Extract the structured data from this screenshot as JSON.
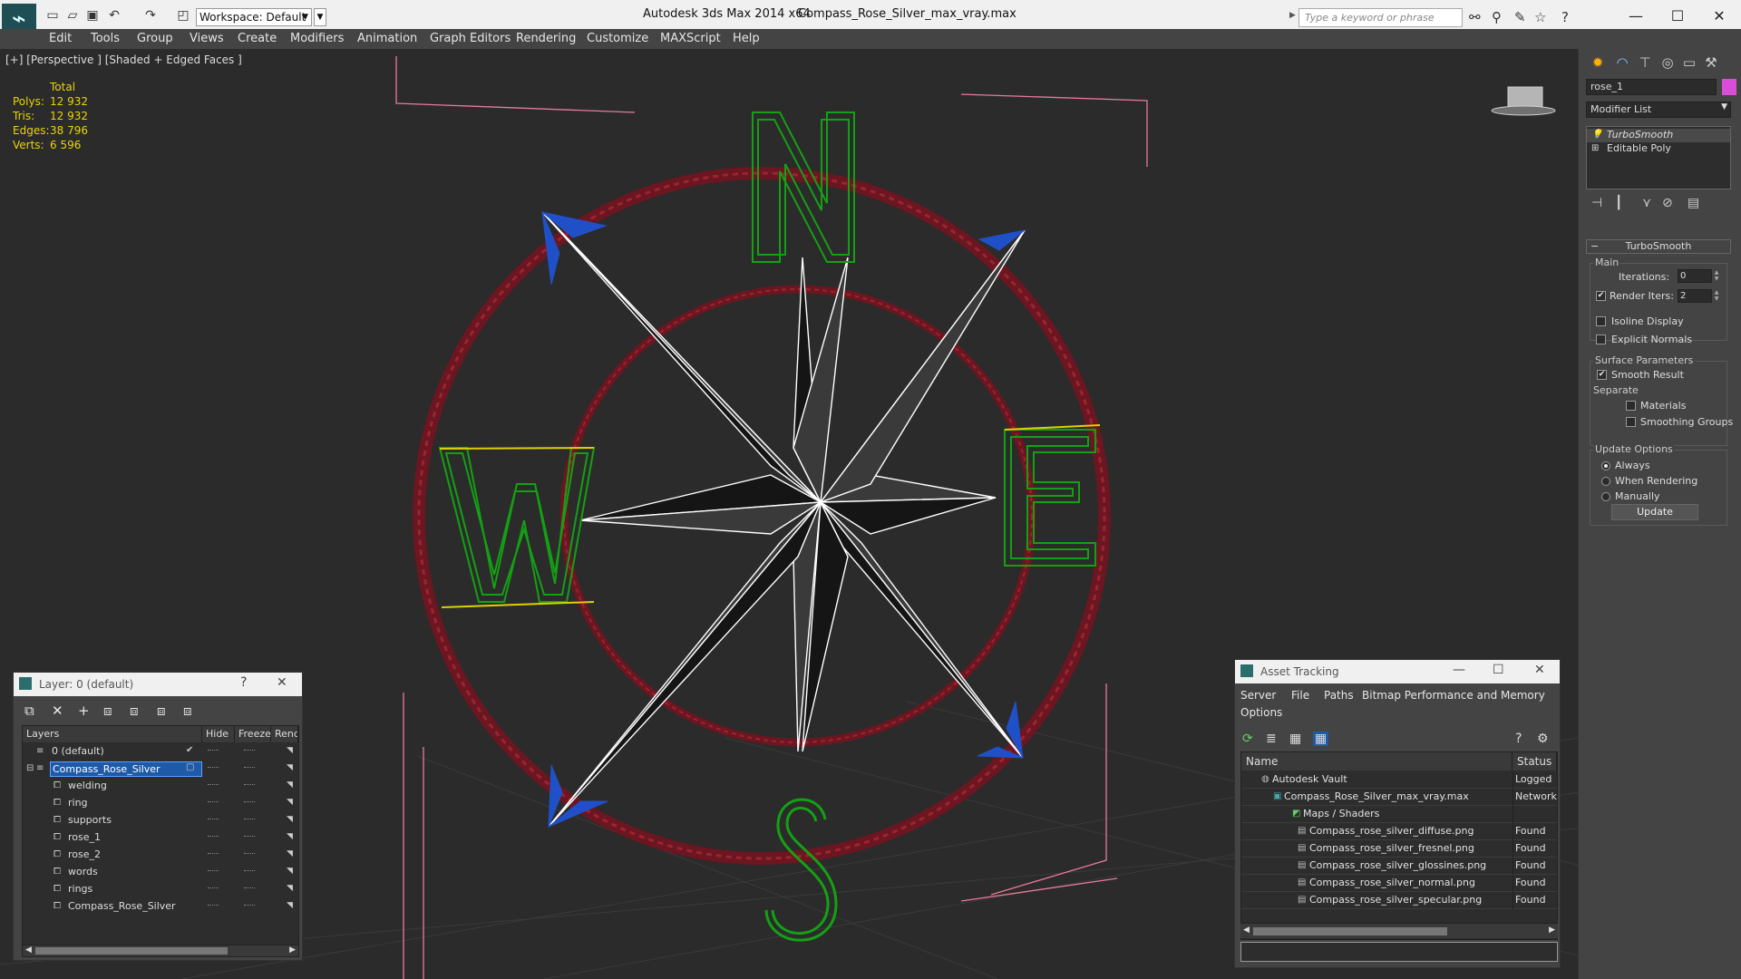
{
  "titlebar": {
    "workspace": "Workspace: Default",
    "app_title": "Autodesk 3ds Max  2014 x64",
    "file_title": "Compass_Rose_Silver_max_vray.max",
    "search_placeholder": "Type a keyword or phrase"
  },
  "menu": [
    "Edit",
    "Tools",
    "Group",
    "Views",
    "Create",
    "Modifiers",
    "Animation",
    "Graph Editors",
    "Rendering",
    "Customize",
    "MAXScript",
    "Help"
  ],
  "viewport": {
    "label": "[+] [Perspective ] [Shaded + Edged Faces ]",
    "stats": {
      "header": "Total",
      "rows": [
        {
          "label": "Polys:",
          "value": "12 932"
        },
        {
          "label": "Tris:",
          "value": "12 932"
        },
        {
          "label": "Edges:",
          "value": "38 796"
        },
        {
          "label": "Verts:",
          "value": "6 596"
        }
      ]
    },
    "colors": {
      "background": "#2b2b2b",
      "ring": "#7a1a22",
      "letters": "#14a014",
      "star_edges": "#ffffff",
      "bounding_box": "#e87a9a",
      "selection_arrows": "#2050c8"
    }
  },
  "command_panel": {
    "object_name": "rose_1",
    "object_color": "#d94ed7",
    "modifier_list": "Modifier List",
    "stack": [
      "TurboSmooth",
      "Editable Poly"
    ],
    "rollout_title": "TurboSmooth",
    "main_group": "Main",
    "iterations_label": "Iterations:",
    "iterations_value": "0",
    "render_iters_label": "Render Iters:",
    "render_iters_value": "2",
    "isoline_label": "Isoline Display",
    "explicit_normals_label": "Explicit Normals",
    "surface_group": "Surface Parameters",
    "smooth_result_label": "Smooth Result",
    "separate_label": "Separate",
    "materials_label": "Materials",
    "smoothing_groups_label": "Smoothing Groups",
    "update_group": "Update Options",
    "always_label": "Always",
    "when_rendering_label": "When Rendering",
    "manually_label": "Manually",
    "update_button": "Update"
  },
  "layer_window": {
    "title": "Layer: 0 (default)",
    "help": "?",
    "columns": [
      "Layers",
      "Hide",
      "Freeze",
      "Rende"
    ],
    "rows": [
      {
        "name": "0 (default)",
        "indent": 0
      },
      {
        "name": "Compass_Rose_Silver",
        "indent": 0
      },
      {
        "name": "welding",
        "indent": 1
      },
      {
        "name": "ring",
        "indent": 1
      },
      {
        "name": "supports",
        "indent": 1
      },
      {
        "name": "rose_1",
        "indent": 1
      },
      {
        "name": "rose_2",
        "indent": 1
      },
      {
        "name": "words",
        "indent": 1
      },
      {
        "name": "rings",
        "indent": 1
      },
      {
        "name": "Compass_Rose_Silver",
        "indent": 1
      }
    ]
  },
  "asset_window": {
    "title": "Asset Tracking",
    "menu": [
      "Server",
      "File",
      "Paths",
      "Bitmap Performance and Memory",
      "Options"
    ],
    "columns": [
      "Name",
      "Status"
    ],
    "rows": [
      {
        "name": "Autodesk Vault",
        "status": "Logged",
        "indent": 1
      },
      {
        "name": "Compass_Rose_Silver_max_vray.max",
        "status": "Network",
        "indent": 2
      },
      {
        "name": "Maps / Shaders",
        "status": "",
        "indent": 3
      },
      {
        "name": "Compass_rose_silver_diffuse.png",
        "status": "Found",
        "indent": 4
      },
      {
        "name": "Compass_rose_silver_fresnel.png",
        "status": "Found",
        "indent": 4
      },
      {
        "name": "Compass_rose_silver_glossines.png",
        "status": "Found",
        "indent": 4
      },
      {
        "name": "Compass_rose_silver_normal.png",
        "status": "Found",
        "indent": 4
      },
      {
        "name": "Compass_rose_silver_specular.png",
        "status": "Found",
        "indent": 4
      }
    ]
  }
}
